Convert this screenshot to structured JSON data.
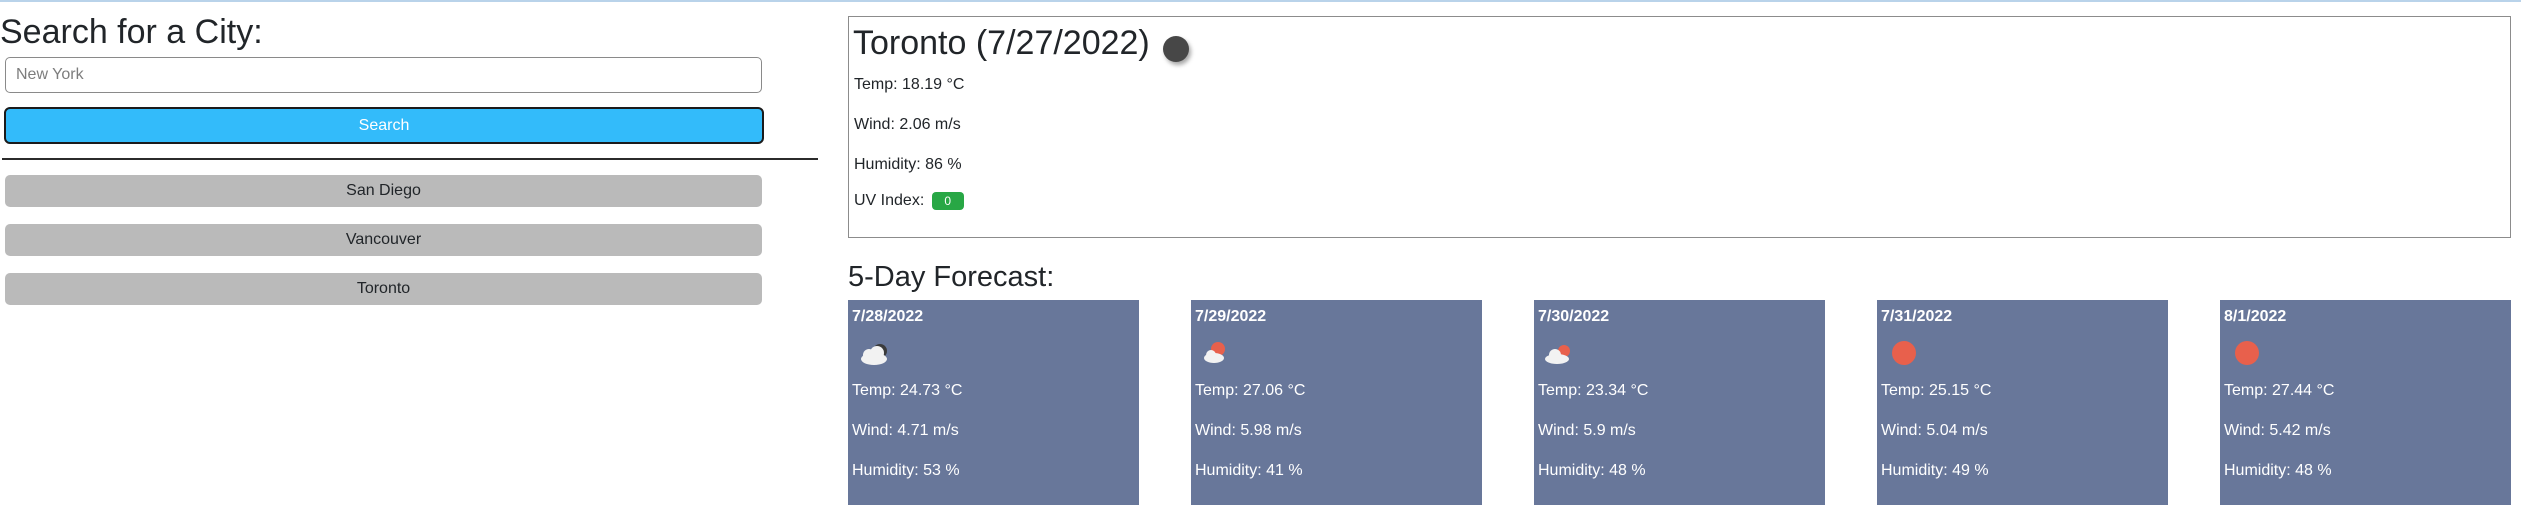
{
  "search": {
    "title": "Search for a City:",
    "placeholder": "New York",
    "button_label": "Search"
  },
  "history": {
    "items": [
      "San Diego",
      "Vancouver",
      "Toronto"
    ]
  },
  "current": {
    "title": "Toronto (7/27/2022)",
    "icon": "moon-icon",
    "temp": "Temp: 18.19 °C",
    "wind": "Wind: 2.06 m/s",
    "humidity": "Humidity: 86 %",
    "uv_label": "UV Index:",
    "uv_value": "0",
    "uv_color": "#28a745"
  },
  "forecast": {
    "title": "5-Day Forecast:",
    "card_color": "#68779a",
    "days": [
      {
        "date": "7/28/2022",
        "icon": "cloudy-night-icon",
        "temp": "Temp: 24.73 °C",
        "wind": "Wind: 4.71 m/s",
        "humidity": "Humidity: 53 %"
      },
      {
        "date": "7/29/2022",
        "icon": "partly-cloudy-icon",
        "temp": "Temp: 27.06 °C",
        "wind": "Wind: 5.98 m/s",
        "humidity": "Humidity: 41 %"
      },
      {
        "date": "7/30/2022",
        "icon": "partly-cloudy-icon",
        "temp": "Temp: 23.34 °C",
        "wind": "Wind: 5.9 m/s",
        "humidity": "Humidity: 48 %"
      },
      {
        "date": "7/31/2022",
        "icon": "sun-icon",
        "temp": "Temp: 25.15 °C",
        "wind": "Wind: 5.04 m/s",
        "humidity": "Humidity: 49 %"
      },
      {
        "date": "8/1/2022",
        "icon": "sun-icon",
        "temp": "Temp: 27.44 °C",
        "wind": "Wind: 5.42 m/s",
        "humidity": "Humidity: 48 %"
      }
    ]
  },
  "colors": {
    "search_button": "#33bbfa",
    "history_button": "#bababa",
    "sun": "#e8604c"
  }
}
